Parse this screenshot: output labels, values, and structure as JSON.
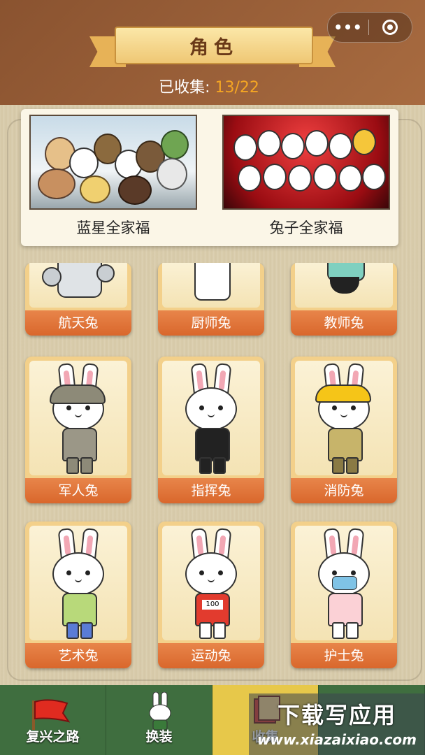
{
  "header": {
    "title": "角色"
  },
  "capsule": {
    "more_icon": "more-dots-icon",
    "close_icon": "record-close-icon"
  },
  "collection": {
    "label": "已收集:",
    "count": "13",
    "separator": "/",
    "total": "22"
  },
  "family": [
    {
      "caption": "蓝星全家福"
    },
    {
      "caption": "兔子全家福"
    }
  ],
  "characters": [
    {
      "name": "航天兔",
      "color": "#dfe3e6"
    },
    {
      "name": "厨师兔",
      "color": "#ffffff"
    },
    {
      "name": "教师兔",
      "color": "#7fd0c0"
    },
    {
      "name": "军人兔",
      "color": "#9b9787"
    },
    {
      "name": "指挥兔",
      "color": "#222222"
    },
    {
      "name": "消防兔",
      "color": "#c7b46a"
    },
    {
      "name": "艺术兔",
      "color": "#b8d97a"
    },
    {
      "name": "运动兔",
      "color": "#e23b2e",
      "bib": "100"
    },
    {
      "name": "护士兔",
      "color": "#fbd1d6"
    }
  ],
  "tabs": [
    {
      "label": "复兴之路",
      "icon": "red-flag-icon"
    },
    {
      "label": "换装",
      "icon": "rabbit-icon"
    },
    {
      "label": "收集",
      "icon": "collection-icon",
      "active": true
    },
    {
      "label": "",
      "icon": "more-icon"
    }
  ],
  "watermark": {
    "line1": "下载写应用",
    "line2": "www.xiazaixiao.com"
  }
}
